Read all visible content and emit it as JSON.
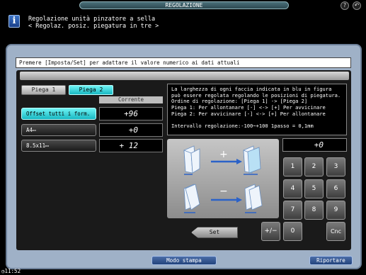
{
  "header": {
    "title": "REGOLAZIONE",
    "message_line1": "Regolazione unità pinzatore a sella",
    "message_line2": "< Regolaz. posiz. piegatura in tre >"
  },
  "instruction": "Premere [Imposta/Set] per adattare il valore numerico ai dati attuali",
  "tabs": {
    "tab1": "Piega 1",
    "tab2": "Piega 2",
    "active": "Piega 2"
  },
  "column_header": "Corrente",
  "options": [
    {
      "label": "Offset tutti i form.",
      "value": "+96",
      "selected": true
    },
    {
      "label": "A4▭",
      "value": "+0",
      "selected": false
    },
    {
      "label": "8.5x11▭",
      "value": "+ 12",
      "selected": false
    }
  ],
  "description": [
    "La larghezza di ogni faccia indicata in blu in figura",
    "può essere regolata regolando le posizioni di piegatura.",
    "Ordine di regolazione: [Piega 1] -> [Piega 2]",
    "Piega 1: Per allontanare [-] <-> [+] Per avvicinare",
    "Piega 2: Per avvicinare [-] <-> [+] Per allontanare",
    "",
    "Intervallo regolazione:-100~+100 1passo = 0,1mm"
  ],
  "diagram": {
    "plus_symbol": "+",
    "minus_symbol": "−"
  },
  "keypad": {
    "display": "+0",
    "keys": [
      "1",
      "2",
      "3",
      "4",
      "5",
      "6",
      "7",
      "8",
      "9"
    ],
    "plusminus": "+/−",
    "zero": "0",
    "cnc": "Cnc"
  },
  "set_button": "Set",
  "footer": {
    "modo_stampa": "Modo stampa",
    "riportare": "Riportare",
    "clock": "11:52"
  },
  "colors": {
    "accent_cyan": "#17b7c2",
    "panel": "#9fb1c7",
    "footer_button": "#23437c"
  },
  "icons": [
    "info-icon",
    "help-icon",
    "back-icon",
    "clock-icon",
    "paper-icon"
  ]
}
